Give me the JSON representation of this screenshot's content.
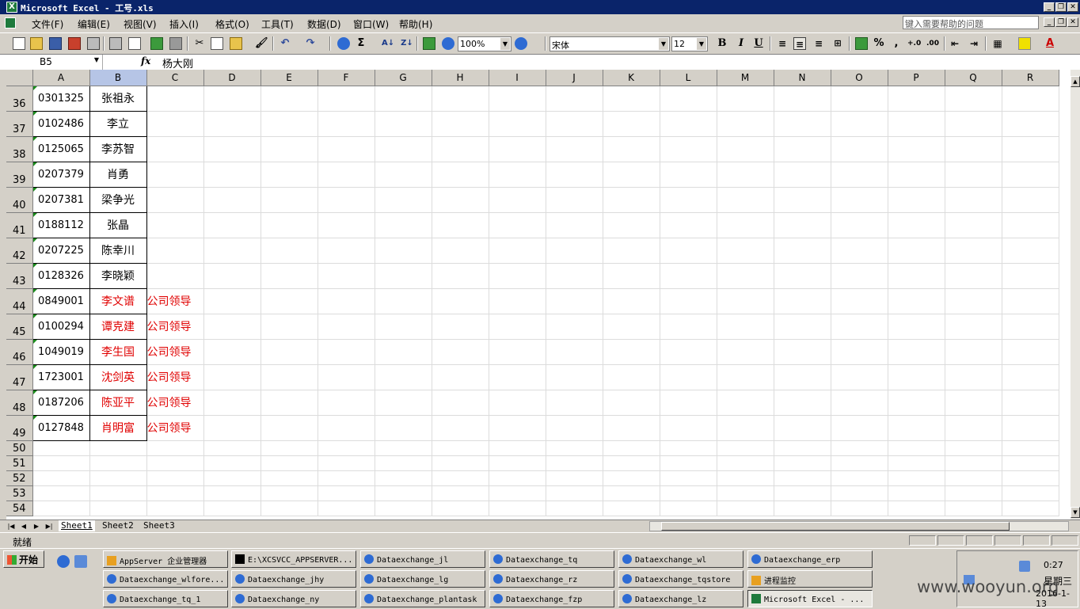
{
  "window": {
    "title": "Microsoft Excel - 工号.xls",
    "title_prefix_icon": "excel-icon",
    "min_label": "_",
    "restore_label": "❐",
    "close_label": "✕"
  },
  "menu": {
    "items": [
      "文件(F)",
      "编辑(E)",
      "视图(V)",
      "插入(I)",
      "格式(O)",
      "工具(T)",
      "数据(D)",
      "窗口(W)",
      "帮助(H)"
    ],
    "help_placeholder": "键入需要帮助的问题"
  },
  "toolbar": {
    "zoom": "100%",
    "font": "宋体",
    "size": "12",
    "bold": "B",
    "italic": "I",
    "underline": "U",
    "sum": "Σ",
    "percent": "%",
    "comma": ","
  },
  "formula": {
    "cell_ref": "B5",
    "fx": "fx",
    "value": "杨大刚"
  },
  "grid": {
    "columns": [
      "A",
      "B",
      "C",
      "D",
      "E",
      "F",
      "G",
      "H",
      "I",
      "J",
      "K",
      "L",
      "M",
      "N",
      "O",
      "P",
      "Q",
      "R"
    ],
    "selected_column": "B",
    "rows": [
      {
        "n": "36",
        "a": "0301325",
        "b": "张祖永",
        "c": "",
        "red": false
      },
      {
        "n": "37",
        "a": "0102486",
        "b": "李立",
        "c": "",
        "red": false
      },
      {
        "n": "38",
        "a": "0125065",
        "b": "李苏智",
        "c": "",
        "red": false
      },
      {
        "n": "39",
        "a": "0207379",
        "b": "肖勇",
        "c": "",
        "red": false
      },
      {
        "n": "40",
        "a": "0207381",
        "b": "梁争光",
        "c": "",
        "red": false
      },
      {
        "n": "41",
        "a": "0188112",
        "b": "张晶",
        "c": "",
        "red": false
      },
      {
        "n": "42",
        "a": "0207225",
        "b": "陈幸川",
        "c": "",
        "red": false
      },
      {
        "n": "43",
        "a": "0128326",
        "b": "李晓颖",
        "c": "",
        "red": false
      },
      {
        "n": "44",
        "a": "0849001",
        "b": "李文谱",
        "c": "公司领导",
        "red": true
      },
      {
        "n": "45",
        "a": "0100294",
        "b": "谭克建",
        "c": "公司领导",
        "red": true
      },
      {
        "n": "46",
        "a": "1049019",
        "b": "李生国",
        "c": "公司领导",
        "red": true
      },
      {
        "n": "47",
        "a": "1723001",
        "b": "沈剑英",
        "c": "公司领导",
        "red": true
      },
      {
        "n": "48",
        "a": "0187206",
        "b": "陈亚平",
        "c": "公司领导",
        "red": true
      },
      {
        "n": "49",
        "a": "0127848",
        "b": "肖明富",
        "c": "公司领导",
        "red": true
      }
    ],
    "empty_rows": [
      "50",
      "51",
      "52",
      "53",
      "54"
    ]
  },
  "sheets": {
    "tabs": [
      "Sheet1",
      "Sheet2",
      "Sheet3"
    ],
    "active": "Sheet1"
  },
  "status": {
    "text": "就绪"
  },
  "taskbar": {
    "start": "开始",
    "tasks": [
      {
        "label": "AppServer 企业管理器",
        "icon": "app",
        "active": false
      },
      {
        "label": "E:\\XCSVCC_APPSERVER...",
        "icon": "cmd",
        "active": false
      },
      {
        "label": "Dataexchange_jl",
        "icon": "ie",
        "active": false
      },
      {
        "label": "Dataexchange_tq",
        "icon": "ie",
        "active": false
      },
      {
        "label": "Dataexchange_wl",
        "icon": "ie",
        "active": false
      },
      {
        "label": "Dataexchange_erp",
        "icon": "ie",
        "active": false
      },
      {
        "label": "Dataexchange_wlfore...",
        "icon": "ie",
        "active": false
      },
      {
        "label": "Dataexchange_jhy",
        "icon": "ie",
        "active": false
      },
      {
        "label": "Dataexchange_lg",
        "icon": "ie",
        "active": false
      },
      {
        "label": "Dataexchange_rz",
        "icon": "ie",
        "active": false
      },
      {
        "label": "Dataexchange_tqstore",
        "icon": "ie",
        "active": false
      },
      {
        "label": "进程监控",
        "icon": "app",
        "active": false
      },
      {
        "label": "Dataexchange_tq_1",
        "icon": "ie",
        "active": false
      },
      {
        "label": "Dataexchange_ny",
        "icon": "ie",
        "active": false
      },
      {
        "label": "Dataexchange_plantask",
        "icon": "ie",
        "active": false
      },
      {
        "label": "Dataexchange_fzp",
        "icon": "ie",
        "active": false
      },
      {
        "label": "Dataexchange_lz",
        "icon": "ie",
        "active": false
      },
      {
        "label": "Microsoft Excel - ...",
        "icon": "xl",
        "active": true
      }
    ],
    "clock": "0:27",
    "weekday": "星期三",
    "date": "2016-1-13"
  },
  "watermark": "www.wooyun.org"
}
